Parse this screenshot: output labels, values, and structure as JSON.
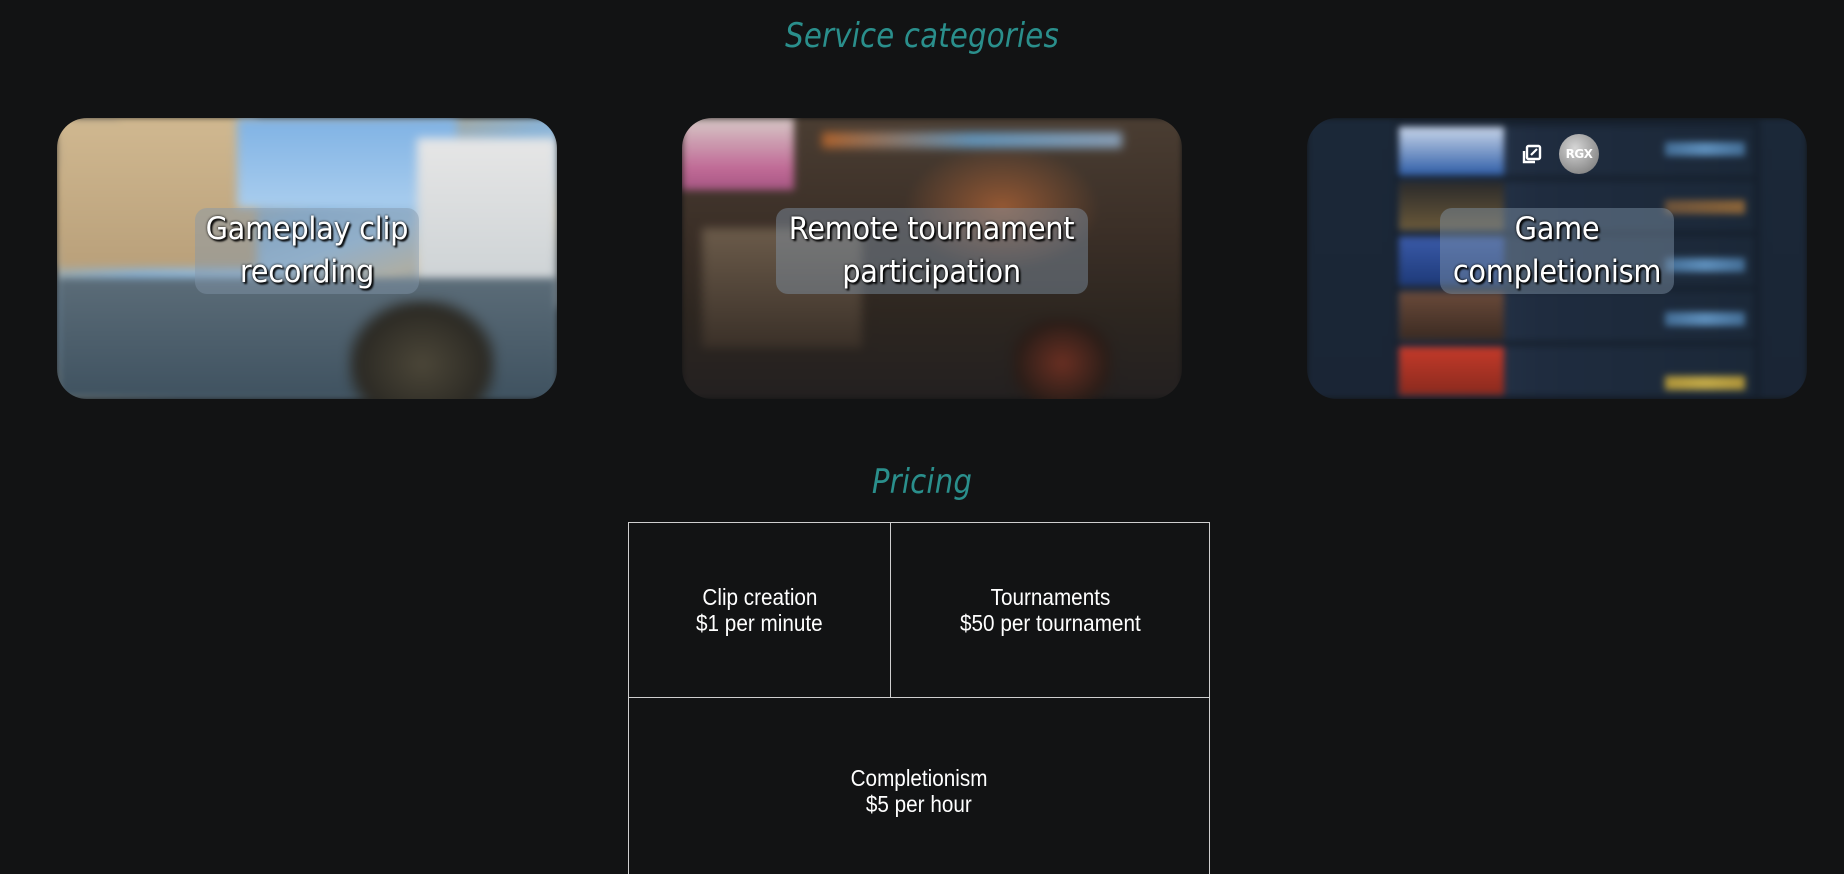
{
  "headings": {
    "services": "Service categories",
    "pricing": "Pricing"
  },
  "services": [
    {
      "title_line1": "Gameplay clip",
      "title_line2": "recording"
    },
    {
      "title_line1": "Remote tournament",
      "title_line2": "participation"
    },
    {
      "title_line1": "Game",
      "title_line2": "completionism",
      "badge": "RGX"
    }
  ],
  "pricing": {
    "clip": {
      "name": "Clip creation",
      "price": "$1 per minute"
    },
    "tournaments": {
      "name": "Tournaments",
      "price": "$50 per tournament"
    },
    "completionism": {
      "name": "Completionism",
      "price": "$5 per hour"
    }
  },
  "icons": {
    "popout": "popout-icon"
  },
  "colors": {
    "background": "#121314",
    "accent": "#2a8f8c",
    "table_border": "#cfcfcf"
  }
}
